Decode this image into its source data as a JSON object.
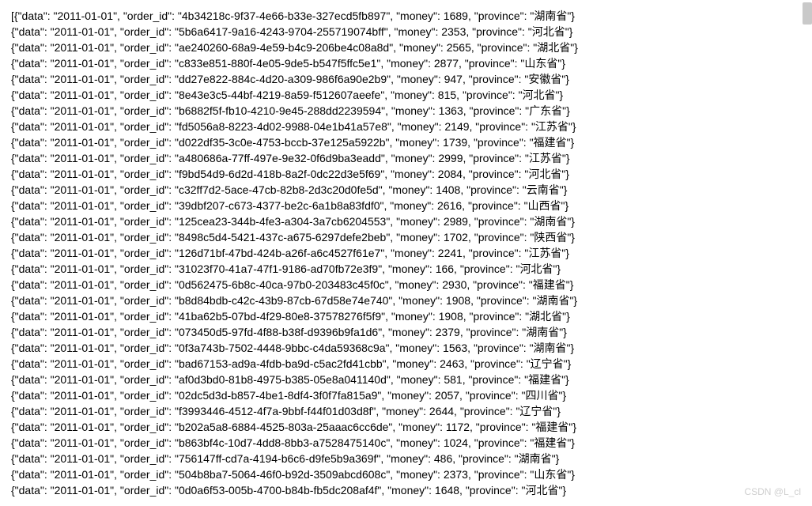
{
  "records": [
    {
      "data": "2011-01-01",
      "order_id": "4b34218c-9f37-4e66-b33e-327ecd5fb897",
      "money": 1689,
      "province": "湖南省"
    },
    {
      "data": "2011-01-01",
      "order_id": "5b6a6417-9a16-4243-9704-255719074bff",
      "money": 2353,
      "province": "河北省"
    },
    {
      "data": "2011-01-01",
      "order_id": "ae240260-68a9-4e59-b4c9-206be4c08a8d",
      "money": 2565,
      "province": "湖北省"
    },
    {
      "data": "2011-01-01",
      "order_id": "c833e851-880f-4e05-9de5-b547f5ffc5e1",
      "money": 2877,
      "province": "山东省"
    },
    {
      "data": "2011-01-01",
      "order_id": "dd27e822-884c-4d20-a309-986f6a90e2b9",
      "money": 947,
      "province": "安徽省"
    },
    {
      "data": "2011-01-01",
      "order_id": "8e43e3c5-44bf-4219-8a59-f512607aeefe",
      "money": 815,
      "province": "河北省"
    },
    {
      "data": "2011-01-01",
      "order_id": "b6882f5f-fb10-4210-9e45-288dd2239594",
      "money": 1363,
      "province": "广东省"
    },
    {
      "data": "2011-01-01",
      "order_id": "fd5056a8-8223-4d02-9988-04e1b41a57e8",
      "money": 2149,
      "province": "江苏省"
    },
    {
      "data": "2011-01-01",
      "order_id": "d022df35-3c0e-4753-bccb-37e125a5922b",
      "money": 1739,
      "province": "福建省"
    },
    {
      "data": "2011-01-01",
      "order_id": "a480686a-77ff-497e-9e32-0f6d9ba3eadd",
      "money": 2999,
      "province": "江苏省"
    },
    {
      "data": "2011-01-01",
      "order_id": "f9bd54d9-6d2d-418b-8a2f-0dc22d3e5f69",
      "money": 2084,
      "province": "河北省"
    },
    {
      "data": "2011-01-01",
      "order_id": "c32ff7d2-5ace-47cb-82b8-2d3c20d0fe5d",
      "money": 1408,
      "province": "云南省"
    },
    {
      "data": "2011-01-01",
      "order_id": "39dbf207-c673-4377-be2c-6a1b8a83fdf0",
      "money": 2616,
      "province": "山西省"
    },
    {
      "data": "2011-01-01",
      "order_id": "125cea23-344b-4fe3-a304-3a7cb6204553",
      "money": 2989,
      "province": "湖南省"
    },
    {
      "data": "2011-01-01",
      "order_id": "8498c5d4-5421-437c-a675-6297defe2beb",
      "money": 1702,
      "province": "陕西省"
    },
    {
      "data": "2011-01-01",
      "order_id": "126d71bf-47bd-424b-a26f-a6c4527f61e7",
      "money": 2241,
      "province": "江苏省"
    },
    {
      "data": "2011-01-01",
      "order_id": "31023f70-41a7-47f1-9186-ad70fb72e3f9",
      "money": 166,
      "province": "河北省"
    },
    {
      "data": "2011-01-01",
      "order_id": "0d562475-6b8c-40ca-97b0-203483c45f0c",
      "money": 2930,
      "province": "福建省"
    },
    {
      "data": "2011-01-01",
      "order_id": "b8d84bdb-c42c-43b9-87cb-67d58e74e740",
      "money": 1908,
      "province": "湖南省"
    },
    {
      "data": "2011-01-01",
      "order_id": "41ba62b5-07bd-4f29-80e8-37578276f5f9",
      "money": 1908,
      "province": "湖北省"
    },
    {
      "data": "2011-01-01",
      "order_id": "073450d5-97fd-4f88-b38f-d9396b9fa1d6",
      "money": 2379,
      "province": "湖南省"
    },
    {
      "data": "2011-01-01",
      "order_id": "0f3a743b-7502-4448-9bbc-c4da59368c9a",
      "money": 1563,
      "province": "湖南省"
    },
    {
      "data": "2011-01-01",
      "order_id": "bad67153-ad9a-4fdb-ba9d-c5ac2fd41cbb",
      "money": 2463,
      "province": "辽宁省"
    },
    {
      "data": "2011-01-01",
      "order_id": "af0d3bd0-81b8-4975-b385-05e8a041140d",
      "money": 581,
      "province": "福建省"
    },
    {
      "data": "2011-01-01",
      "order_id": "02dc5d3d-b857-4be1-8df4-3f0f7fa815a9",
      "money": 2057,
      "province": "四川省"
    },
    {
      "data": "2011-01-01",
      "order_id": "f3993446-4512-4f7a-9bbf-f44f01d03d8f",
      "money": 2644,
      "province": "辽宁省"
    },
    {
      "data": "2011-01-01",
      "order_id": "b202a5a8-6884-4525-803a-25aaac6cc6de",
      "money": 1172,
      "province": "福建省"
    },
    {
      "data": "2011-01-01",
      "order_id": "b863bf4c-10d7-4dd8-8bb3-a7528475140c",
      "money": 1024,
      "province": "福建省"
    },
    {
      "data": "2011-01-01",
      "order_id": "756147ff-cd7a-4194-b6c6-d9fe5b9a369f",
      "money": 486,
      "province": "湖南省"
    },
    {
      "data": "2011-01-01",
      "order_id": "504b8ba7-5064-46f0-b92d-3509abcd608c",
      "money": 2373,
      "province": "山东省"
    },
    {
      "data": "2011-01-01",
      "order_id": "0d0a6f53-005b-4700-b84b-fb5dc208af4f",
      "money": 1648,
      "province": "河北省"
    }
  ],
  "prefix": "[",
  "watermark": "CSDN @L_cl"
}
